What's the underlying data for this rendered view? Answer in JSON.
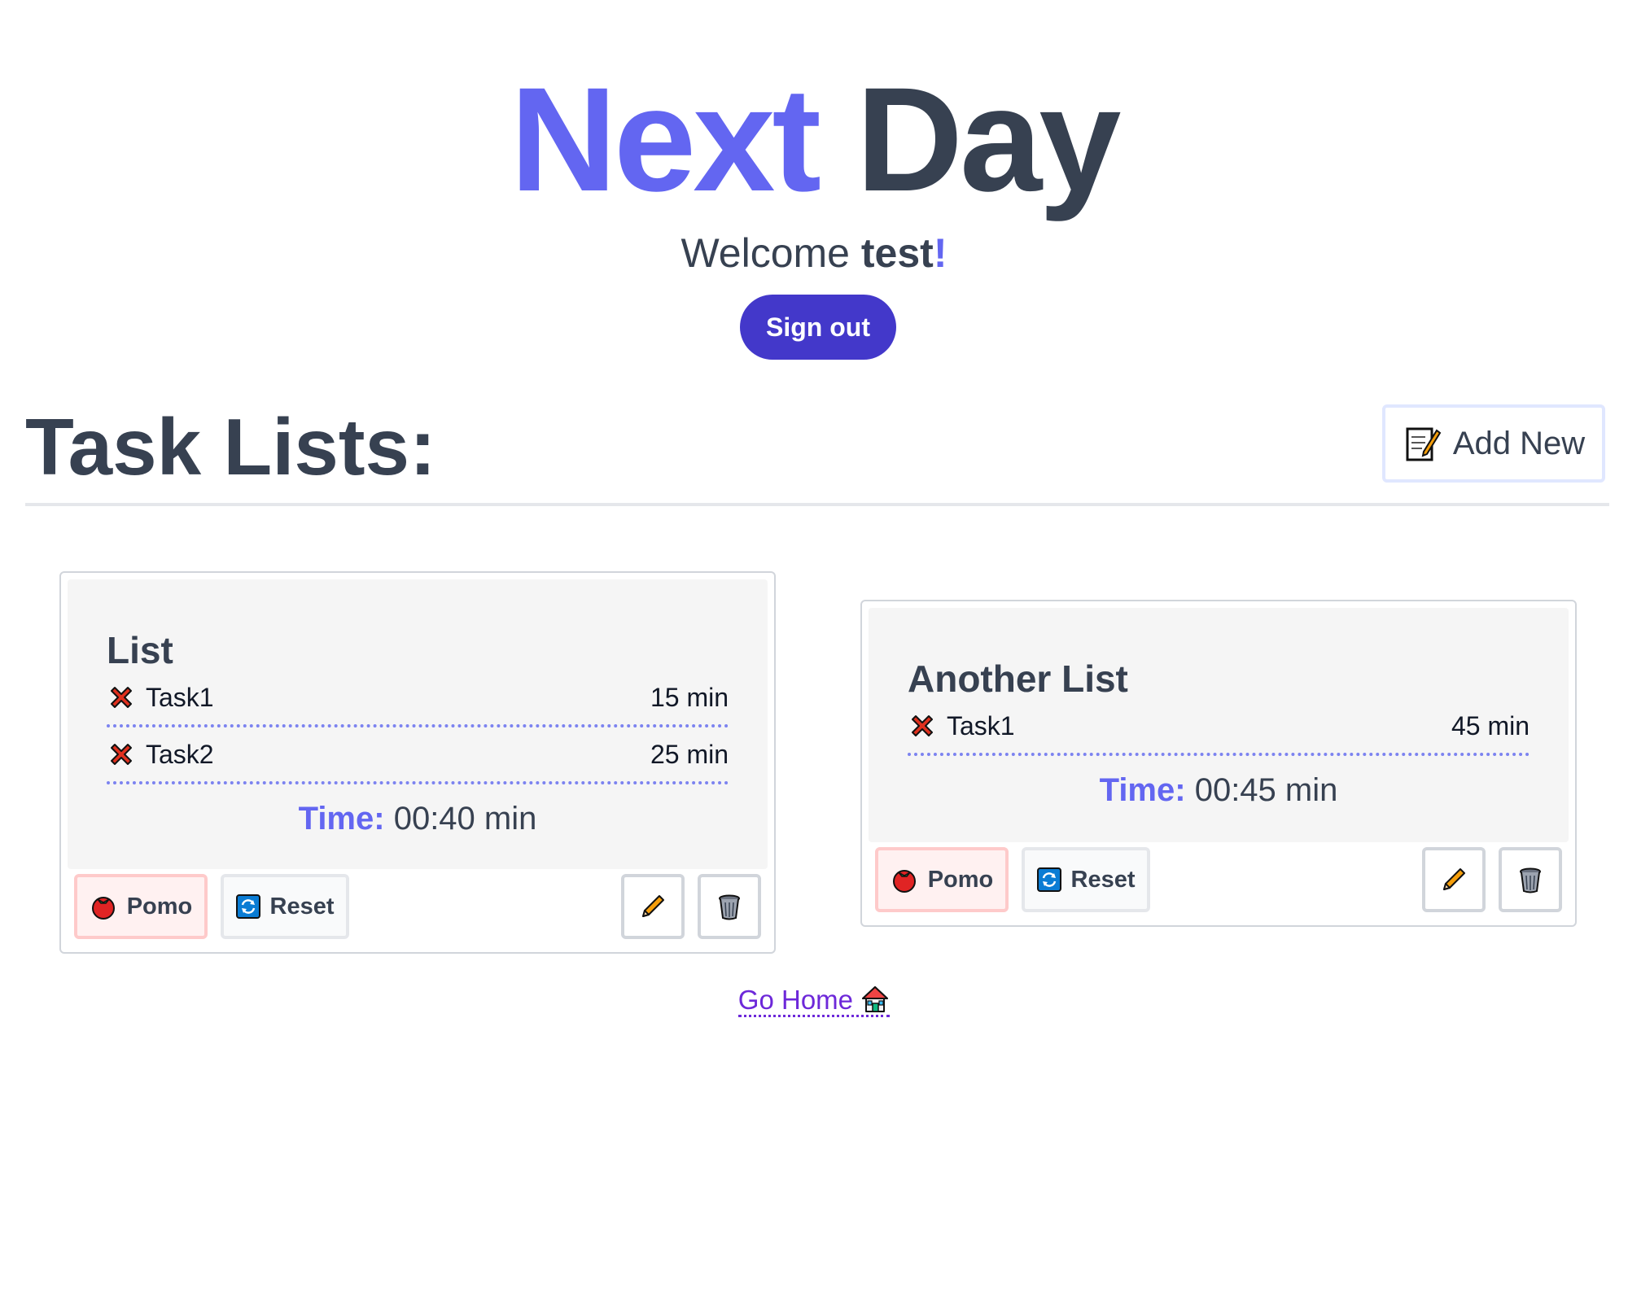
{
  "header": {
    "title_part1": "Next",
    "title_part2": "Day",
    "welcome_prefix": "Welcome",
    "username": "test",
    "welcome_suffix": "!",
    "signout_label": "Sign out"
  },
  "section": {
    "title": "Task Lists:",
    "add_new_label": "Add New",
    "add_new_icon": "memo-icon"
  },
  "lists": [
    {
      "title": "List",
      "tasks": [
        {
          "name": "Task1",
          "time": "15 min",
          "icon": "cross-mark-icon"
        },
        {
          "name": "Task2",
          "time": "25 min",
          "icon": "cross-mark-icon"
        }
      ],
      "time_label": "Time:",
      "time_value": "00:40 min",
      "pomo_label": "Pomo",
      "reset_label": "Reset"
    },
    {
      "title": "Another List",
      "tasks": [
        {
          "name": "Task1",
          "time": "45 min",
          "icon": "cross-mark-icon"
        }
      ],
      "time_label": "Time:",
      "time_value": "00:45 min",
      "pomo_label": "Pomo",
      "reset_label": "Reset"
    }
  ],
  "footer": {
    "go_home_label": "Go Home",
    "go_home_icon": "house-icon"
  },
  "colors": {
    "accent": "#6366f1",
    "signout_bg": "#4338ca",
    "text_dark": "#374151",
    "link": "#6d28d9"
  }
}
